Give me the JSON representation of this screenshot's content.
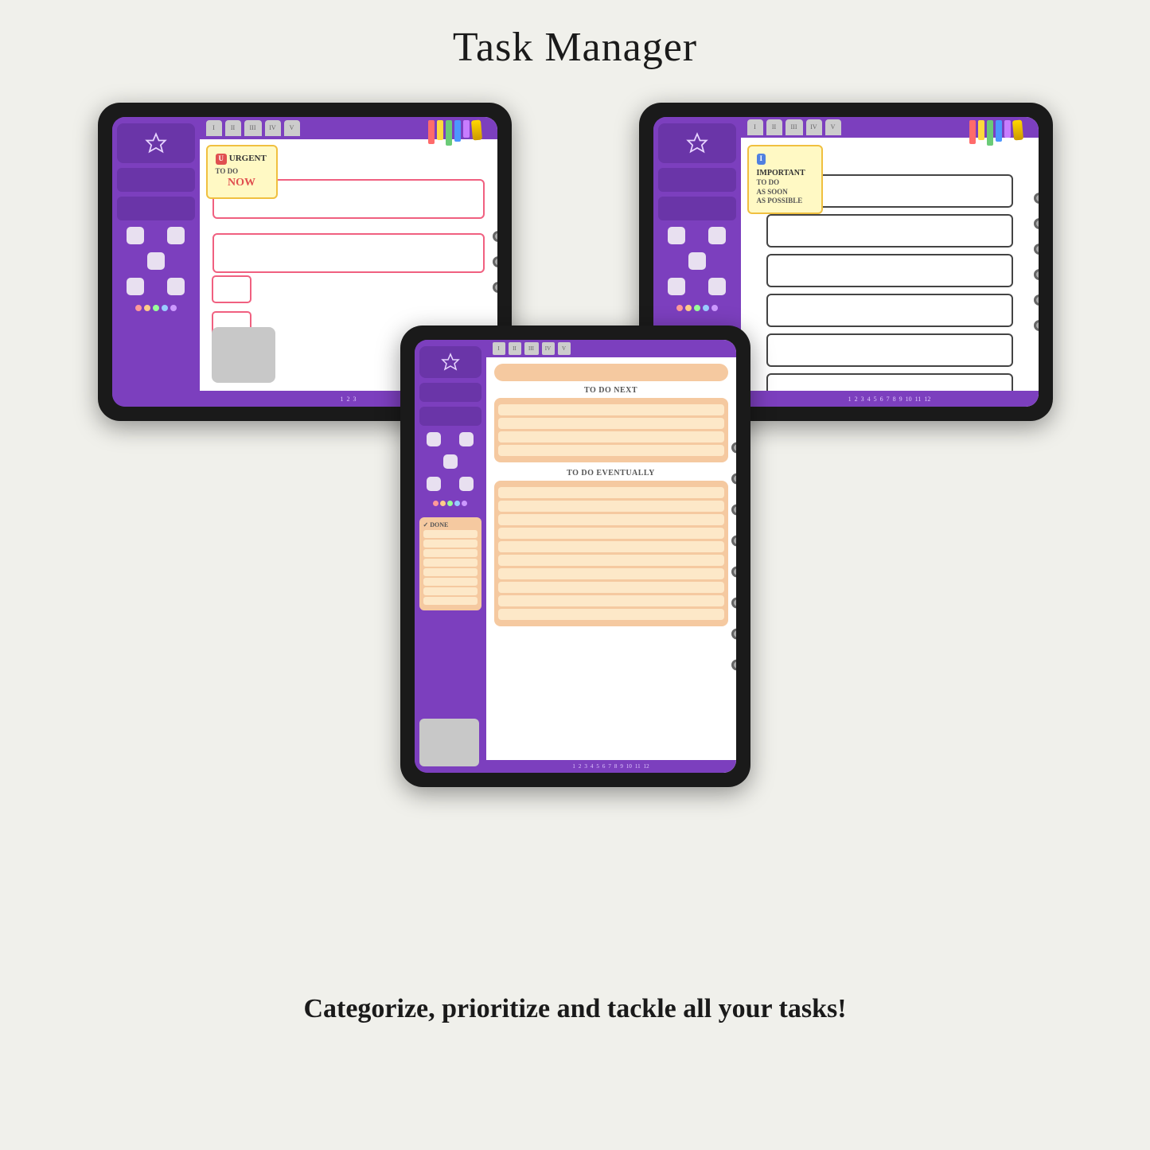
{
  "page": {
    "title": "Task Manager",
    "tagline": "Categorize, prioritize and tackle all your tasks!"
  },
  "tablet_left": {
    "sticky": {
      "badge": "U",
      "badge_color": "#e05050",
      "line1": "URGENT",
      "line2": "TO DO",
      "line3": "NOW"
    },
    "task_boxes": 2
  },
  "tablet_right": {
    "sticky": {
      "badge": "I",
      "badge_color": "#5080e0",
      "line1": "IMPORTANT",
      "line2": "TO DO",
      "line3": "AS SOON",
      "line4": "AS POSSIBLE"
    },
    "task_boxes": 6
  },
  "tablet_center": {
    "section1_label": "TO DO NEXT",
    "section2_label": "TO DO EVENTUALLY",
    "done_label": "✓ DONE"
  },
  "books": [
    {
      "color": "#ff6b6b"
    },
    {
      "color": "#ffd93d"
    },
    {
      "color": "#6bcb77"
    },
    {
      "color": "#4d96ff"
    },
    {
      "color": "#c77dff"
    }
  ]
}
